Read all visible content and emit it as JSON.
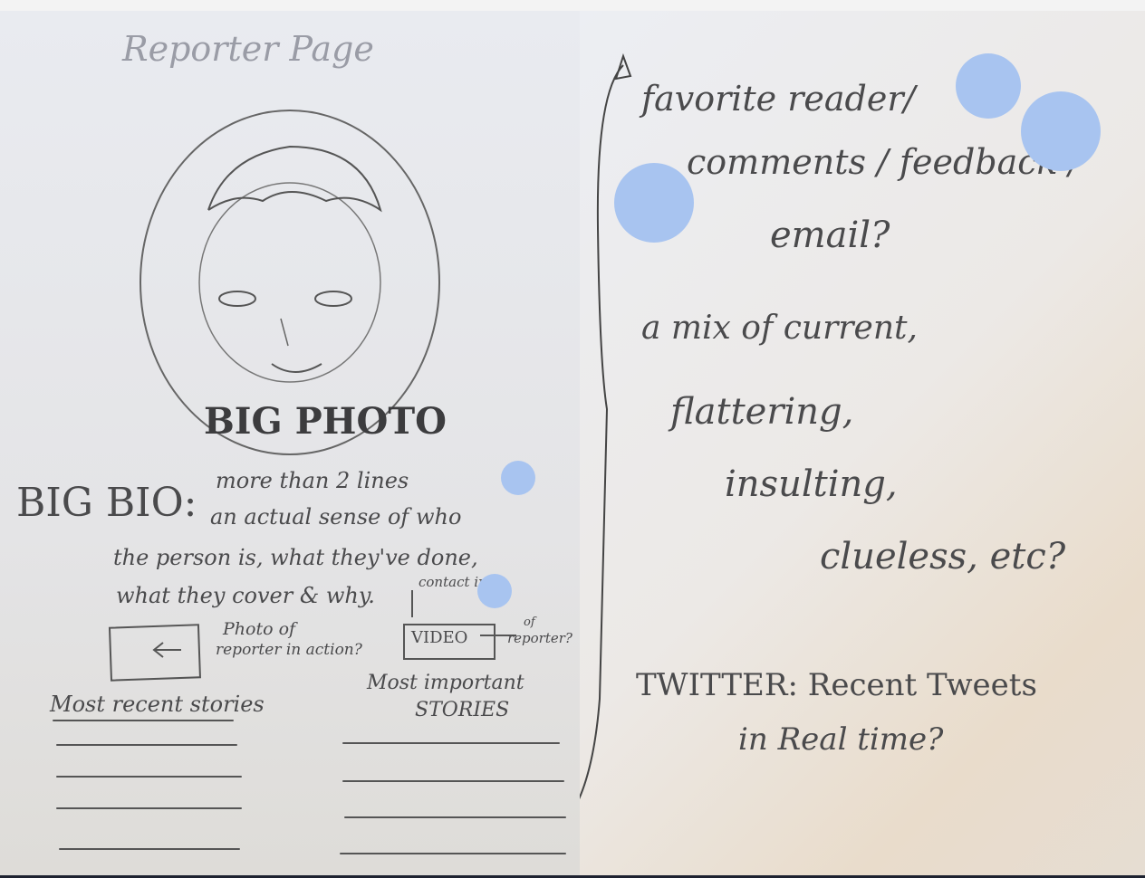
{
  "left_page": {
    "title": "Reporter Page",
    "photo_label": "BIG PHOTO",
    "bio_label": "BIG BIO:",
    "bio_lines": [
      "more than 2 lines",
      "an actual sense of who",
      "the person is, what they've done,",
      "what they cover & why.",
      "contact info"
    ],
    "photo_action": [
      "Photo of",
      "reporter in action?"
    ],
    "video_box": "VIDEO",
    "video_note": [
      "of",
      "reporter?"
    ],
    "recent_heading": "Most recent stories",
    "important_heading": [
      "Most important",
      "STORIES"
    ]
  },
  "right_page": {
    "feedback_lines": [
      "favorite reader/",
      "comments / feedback /",
      "email?"
    ],
    "mix_lines": [
      "a mix of current,",
      "flattering,",
      "insulting,",
      "clueless, etc?"
    ],
    "twitter_lines": [
      "TWITTER: Recent Tweets",
      "in Real time?"
    ]
  },
  "colors": {
    "marker": "#a8c4f0",
    "pencil": "#4a4a4c"
  }
}
